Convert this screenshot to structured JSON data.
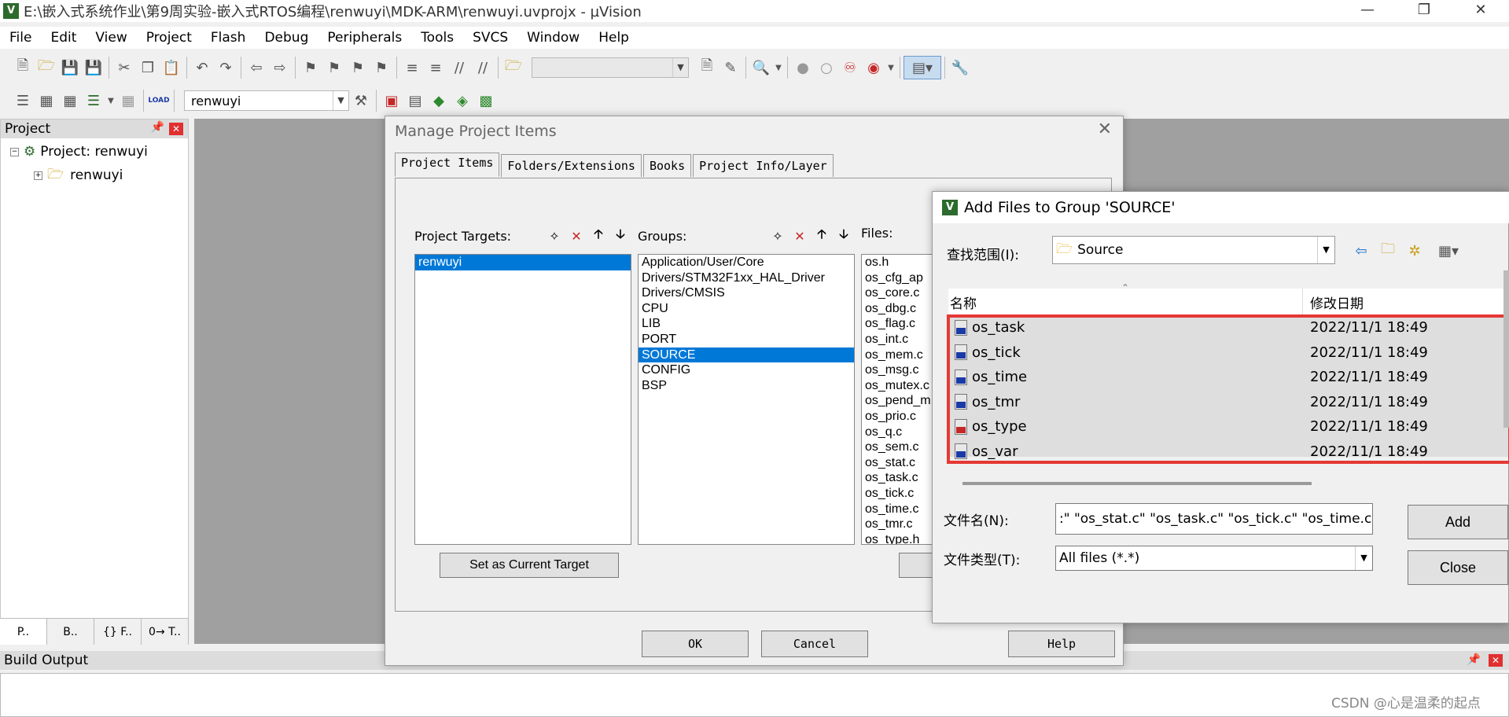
{
  "window": {
    "title": "E:\\嵌入式系统作业\\第9周实验-嵌入式RTOS编程\\renwuyi\\MDK-ARM\\renwuyi.uvprojx - µVision",
    "app_icon": "V"
  },
  "menu": [
    "File",
    "Edit",
    "View",
    "Project",
    "Flash",
    "Debug",
    "Peripherals",
    "Tools",
    "SVCS",
    "Window",
    "Help"
  ],
  "toolbar2": {
    "target_combo": "renwuyi"
  },
  "project_panel": {
    "title": "Project",
    "root": "Project: renwuyi",
    "child": "renwuyi",
    "tabs": [
      "P..",
      "B..",
      "{} F..",
      "0→ T.."
    ]
  },
  "build_output": {
    "title": "Build Output"
  },
  "manage_dialog": {
    "title": "Manage Project Items",
    "tabs": [
      "Project Items",
      "Folders/Extensions",
      "Books",
      "Project Info/Layer"
    ],
    "targets_label": "Project Targets:",
    "targets": [
      "renwuyi"
    ],
    "groups_label": "Groups:",
    "groups": [
      "Application/User/Core",
      "Drivers/STM32F1xx_HAL_Driver",
      "Drivers/CMSIS",
      "CPU",
      "LIB",
      "PORT",
      "SOURCE",
      "CONFIG",
      "BSP"
    ],
    "selected_group": "SOURCE",
    "files_label": "Files:",
    "files": [
      "os.h",
      "os_cfg_ap",
      "os_core.c",
      "os_dbg.c",
      "os_flag.c",
      "os_int.c",
      "os_mem.c",
      "os_msg.c",
      "os_mutex.c",
      "os_pend_m",
      "os_prio.c",
      "os_q.c",
      "os_sem.c",
      "os_stat.c",
      "os_task.c",
      "os_tick.c",
      "os_time.c",
      "os_tmr.c",
      "os_type.h"
    ],
    "set_current_target": "Set as Current Target",
    "ok": "OK",
    "cancel": "Cancel",
    "help": "Help"
  },
  "add_files_dialog": {
    "title": "Add Files to Group 'SOURCE'",
    "lookin_label": "查找范围(I):",
    "lookin_value": "Source",
    "col_name": "名称",
    "col_date": "修改日期",
    "rows": [
      {
        "name": "os_task",
        "date": "2022/11/1 18:49",
        "icon": "c-file-icon"
      },
      {
        "name": "os_tick",
        "date": "2022/11/1 18:49",
        "icon": "c-file-icon"
      },
      {
        "name": "os_time",
        "date": "2022/11/1 18:49",
        "icon": "c-file-icon"
      },
      {
        "name": "os_tmr",
        "date": "2022/11/1 18:49",
        "icon": "c-file-icon"
      },
      {
        "name": "os_type",
        "date": "2022/11/1 18:49",
        "icon": "h-file-icon"
      },
      {
        "name": "os_var",
        "date": "2022/11/1 18:49",
        "icon": "c-file-icon"
      }
    ],
    "filename_label": "文件名(N):",
    "filename_value": ":\" \"os_stat.c\" \"os_task.c\" \"os_tick.c\" \"os_time.c\"",
    "filetype_label": "文件类型(T):",
    "filetype_value": "All files (*.*)",
    "add": "Add",
    "close": "Close"
  },
  "watermark": "CSDN @心是温柔的起点",
  "colors": {
    "selection": "#0078d7",
    "highlight_box": "#e53935",
    "workspace": "#a0a0a0"
  }
}
